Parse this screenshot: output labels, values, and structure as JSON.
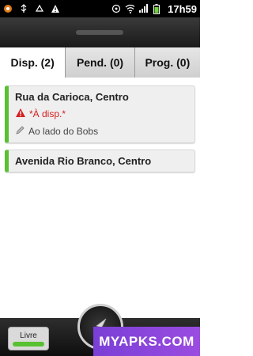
{
  "status_bar": {
    "time": "17h59",
    "left_icons": [
      "app-badge-icon",
      "usb-icon",
      "recycle-icon",
      "warning-icon"
    ],
    "right_icons": [
      "target-icon",
      "wifi-icon",
      "signal-icon",
      "battery-icon"
    ]
  },
  "tabs": [
    {
      "label": "Disp. (2)",
      "active": true
    },
    {
      "label": "Pend. (0)",
      "active": false
    },
    {
      "label": "Prog. (0)",
      "active": false
    }
  ],
  "list": [
    {
      "title": "Rua da Carioca, Centro",
      "warning": "*À disp.*",
      "note": "Ao lado do Bobs"
    },
    {
      "title": "Avenida Rio Branco, Centro"
    }
  ],
  "bottom": {
    "status_label": "Livre",
    "watermark": "MYAPKS.COM"
  },
  "colors": {
    "accent_green": "#58c132",
    "warning_red": "#d42020",
    "watermark_purple": "#8a45db"
  }
}
